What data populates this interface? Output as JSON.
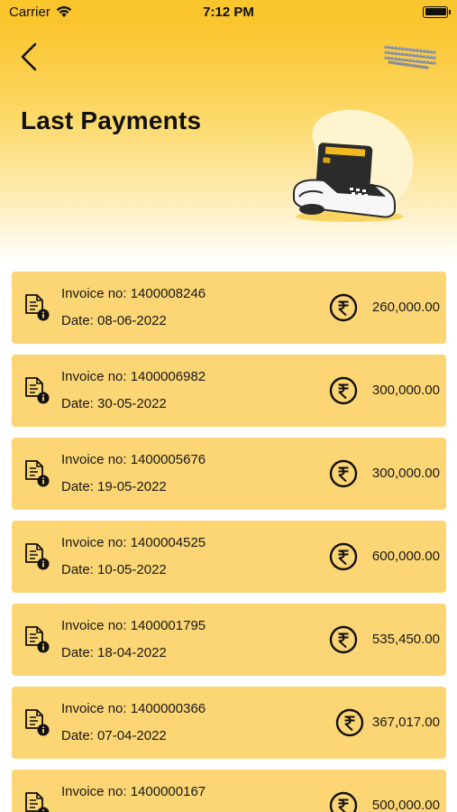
{
  "status_bar": {
    "carrier": "Carrier",
    "time": "7:12 PM"
  },
  "header": {
    "title": "Last Payments"
  },
  "colors": {
    "accent": "#fbc52e",
    "card": "#fcd574"
  },
  "payments": [
    {
      "invoice": "Invoice no: 1400008246",
      "date": "Date: 08-06-2022",
      "amount": "260,000.00"
    },
    {
      "invoice": "Invoice no: 1400006982",
      "date": "Date: 30-05-2022",
      "amount": "300,000.00"
    },
    {
      "invoice": "Invoice no: 1400005676",
      "date": "Date: 19-05-2022",
      "amount": "300,000.00"
    },
    {
      "invoice": "Invoice no: 1400004525",
      "date": "Date: 10-05-2022",
      "amount": "600,000.00"
    },
    {
      "invoice": "Invoice no: 1400001795",
      "date": "Date: 18-04-2022",
      "amount": "535,450.00"
    },
    {
      "invoice": "Invoice no: 1400000366",
      "date": "Date: 07-04-2022",
      "amount": "367,017.00"
    },
    {
      "invoice": "Invoice no: 1400000167",
      "date": "",
      "amount": "500,000.00"
    }
  ]
}
